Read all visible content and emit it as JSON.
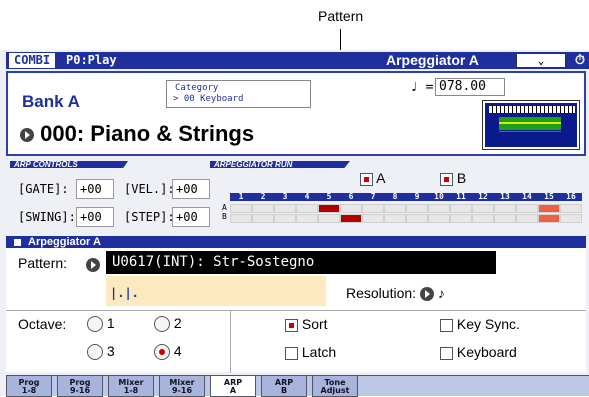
{
  "callout": "Pattern",
  "topbar": {
    "mode": "COMBI",
    "program": "P0:Play",
    "page": "Arpeggiator A",
    "menu_icon": "chevron-down-icon",
    "timer_icon": "stopwatch-icon"
  },
  "bank": {
    "name": "Bank A",
    "category_title": "Category",
    "category_value": "> 00 Keyboard",
    "number": "000",
    "name_full": ": Piano & Strings"
  },
  "tempo": {
    "symbol": "♩ =",
    "value": "078.00"
  },
  "arp_controls": {
    "header": "ARP CONTROLS",
    "gate_label": "[GATE]:",
    "gate": "+00",
    "vel_label": "[VEL.]:",
    "vel": "+00",
    "swing_label": "[SWING]:",
    "swing": "+00",
    "step_label": "[STEP]:",
    "step": "+00"
  },
  "arp_run": {
    "header": "ARPEGGIATOR RUN",
    "a_label": "A",
    "b_label": "B",
    "steps": [
      "1",
      "2",
      "3",
      "4",
      "5",
      "6",
      "7",
      "8",
      "9",
      "10",
      "11",
      "12",
      "13",
      "14",
      "15",
      "16"
    ],
    "row_a_label": "A",
    "row_b_label": "B"
  },
  "arpeggiator_a": {
    "header": "Arpeggiator A",
    "pattern_label": "Pattern:",
    "pattern_value": "U0617(INT): Str-Sostegno",
    "pattern_icon_text": "|.|.",
    "resolution_label": "Resolution:",
    "resolution_value": "♪"
  },
  "options": {
    "octave_label": "Octave:",
    "octaves": [
      "1",
      "2",
      "3",
      "4"
    ],
    "octave_selected": "4",
    "sort": "Sort",
    "latch": "Latch",
    "key_sync": "Key Sync.",
    "keyboard": "Keyboard"
  },
  "tabs": [
    {
      "l1": "Prog",
      "l2": "1-8"
    },
    {
      "l1": "Prog",
      "l2": "9-16"
    },
    {
      "l1": "Mixer",
      "l2": "1-8"
    },
    {
      "l1": "Mixer",
      "l2": "9-16"
    },
    {
      "l1": "ARP",
      "l2": "A"
    },
    {
      "l1": "ARP",
      "l2": "B"
    },
    {
      "l1": "Tone",
      "l2": "Adjust"
    }
  ],
  "colors": {
    "accent": "#1f2f9e",
    "active_step": "#b00000",
    "highlight_step": "#f06040"
  }
}
